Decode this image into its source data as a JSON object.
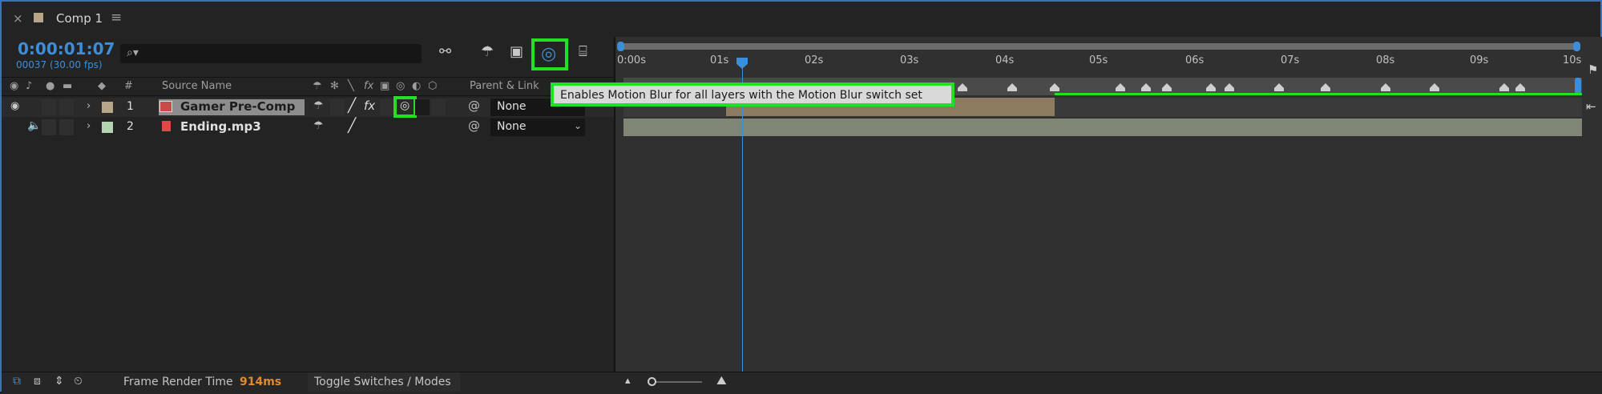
{
  "tab": {
    "close": "×",
    "title": "Comp 1",
    "menu": "≡",
    "swatch_color": "#b8a688"
  },
  "time": {
    "timecode": "0:00:01:07",
    "frames": "00037 (30.00 fps)"
  },
  "search": {
    "icon": "⌕",
    "value": ""
  },
  "toolbar": {
    "icons": [
      "draft-3d-icon",
      "shy-icon",
      "frame-blend-icon",
      "motion-blur-icon",
      "graph-editor-icon"
    ]
  },
  "columns": {
    "label_hash": "#",
    "source_name": "Source Name",
    "parent_link": "Parent & Link",
    "switch_fx": "fx"
  },
  "layers": [
    {
      "num": "1",
      "name": "Gamer Pre-Comp",
      "parent": "None",
      "label_color": "#b8a688",
      "fx": "fx"
    },
    {
      "num": "2",
      "name": "Ending.mp3",
      "parent": "None",
      "label_color": "#b4d4b4"
    }
  ],
  "ruler": {
    "ticks": [
      "0:00s",
      "01s",
      "02s",
      "03s",
      "04s",
      "05s",
      "06s",
      "07s",
      "08s",
      "09s",
      "10s"
    ]
  },
  "tooltip": "Enables Motion Blur for all layers with the Motion Blur switch set",
  "bottom": {
    "frame_render_label": "Frame Render Time",
    "frame_render_value": "914ms",
    "toggle": "Toggle Switches / Modes"
  },
  "colors": {
    "accent_blue": "#3d8ed8",
    "highlight_green": "#22e022",
    "render_orange": "#e08a2e"
  }
}
